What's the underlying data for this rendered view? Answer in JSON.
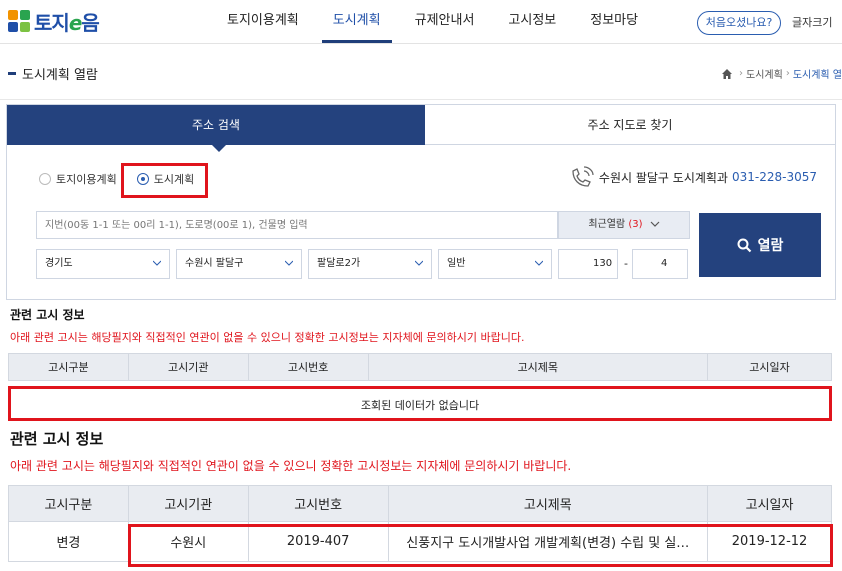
{
  "header": {
    "logo_text_1": "토지",
    "logo_text_2": "e",
    "logo_text_3": "음",
    "logo_colors": [
      "#f29300",
      "#2aa44f",
      "#1f4fa8",
      "#7cc242"
    ],
    "nav": [
      {
        "label": "토지이용계획",
        "active": false
      },
      {
        "label": "도시계획",
        "active": true
      },
      {
        "label": "규제안내서",
        "active": false
      },
      {
        "label": "고시정보",
        "active": false
      },
      {
        "label": "정보마당",
        "active": false
      }
    ],
    "first_visit": "처음오셨나요?",
    "font_size": "글자크기"
  },
  "page": {
    "title": "도시계획 열람",
    "breadcrumb": [
      "도시계획",
      "도시계획 열"
    ]
  },
  "search": {
    "tabs": [
      "주소 검색",
      "주소 지도로 찾기"
    ],
    "radios": [
      {
        "label": "토지이용계획",
        "checked": false
      },
      {
        "label": "도시계획",
        "checked": true
      }
    ],
    "contact_label": "수원시 팔달구 도시계획과",
    "contact_phone": "031-228-3057",
    "address_placeholder": "지번(00동 1-1 또는 00리 1-1), 도로명(00로 1), 건물명 입력",
    "recent_label": "최근열람",
    "recent_count": "(3)",
    "view_button": "열람",
    "selects": {
      "province": "경기도",
      "city": "수원시 팔달구",
      "dong": "팔달로2가",
      "type": "일반"
    },
    "main_no": "130",
    "dash": "-",
    "sub_no": "4"
  },
  "notice1": {
    "title": "관련 고시 정보",
    "notice": "아래 관련 고시는 해당필지와 직접적인 연관이 없을 수 있으니 정확한 고시정보는 지자체에 문의하시기 바랍니다.",
    "columns": [
      "고시구분",
      "고시기관",
      "고시번호",
      "고시제목",
      "고시일자"
    ],
    "empty_message": "조회된 데이터가 없습니다"
  },
  "notice2": {
    "title": "관련 고시 정보",
    "notice": "아래 관련 고시는 해당필지와 직접적인 연관이 없을 수 있으니 정확한 고시정보는 지자체에 문의하시기 바랍니다.",
    "columns": [
      "고시구분",
      "고시기관",
      "고시번호",
      "고시제목",
      "고시일자"
    ],
    "rows": [
      [
        "변경",
        "수원시",
        "2019-407",
        "신풍지구 도시개발사업 개발계획(변경) 수립 및 실…",
        "2019-12-12"
      ]
    ]
  },
  "colors": {
    "primary": "#24427e",
    "link": "#2a5db0",
    "highlight": "#e0141c",
    "header_bg": "#e9ecf1"
  }
}
